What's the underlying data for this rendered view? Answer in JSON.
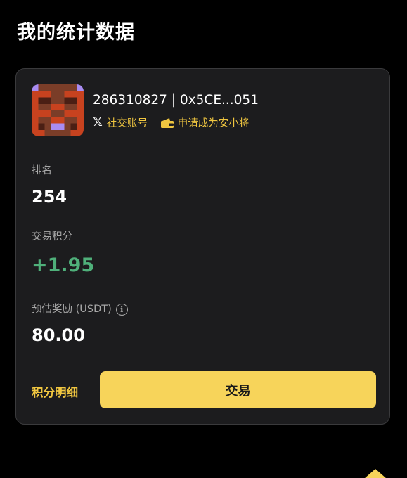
{
  "header": {
    "title": "我的统计数据"
  },
  "account": {
    "id_text": "286310827 | 0x5CE...051",
    "social_label": "社交账号",
    "ambassador_label": "申请成为安小将"
  },
  "stats": {
    "rank_label": "排名",
    "rank_value": "254",
    "points_label": "交易积分",
    "points_value": "+1.95",
    "reward_label": "预估奖励 (USDT)",
    "reward_value": "80.00"
  },
  "actions": {
    "details_label": "积分明细",
    "trade_label": "交易"
  },
  "colors": {
    "accent": "#f0c640",
    "button": "#f7d45a",
    "positive": "#4fb07a",
    "card": "#1c1c1e"
  },
  "icons": {
    "social": "x-logo-icon",
    "ambassador": "wallet-icon",
    "reward_info": "info-icon"
  }
}
